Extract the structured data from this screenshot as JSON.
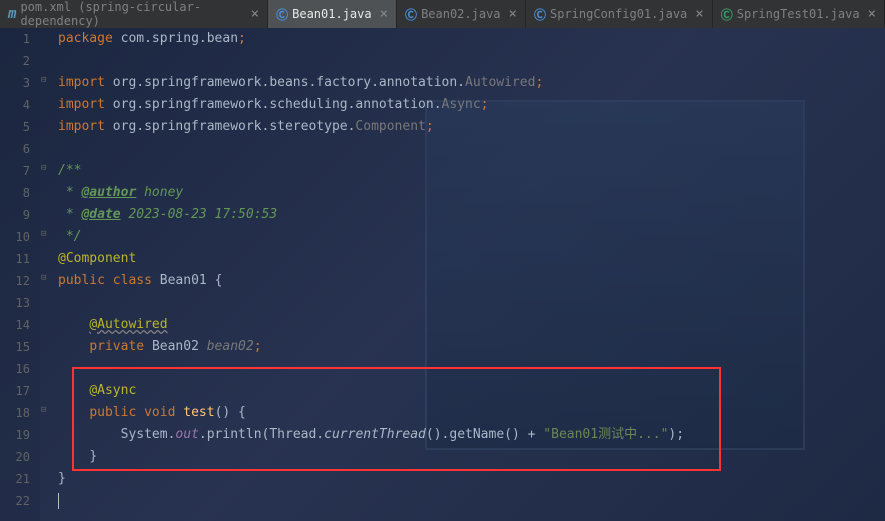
{
  "tabs": [
    {
      "icon": "m",
      "label": "pom.xml (spring-circular-dependency)",
      "active": false
    },
    {
      "icon": "c",
      "label": "Bean01.java",
      "active": true
    },
    {
      "icon": "c",
      "label": "Bean02.java",
      "active": false
    },
    {
      "icon": "c",
      "label": "SpringConfig01.java",
      "active": false
    },
    {
      "icon": "c2",
      "label": "SpringTest01.java",
      "active": false
    }
  ],
  "lines": [
    "1",
    "2",
    "3",
    "4",
    "5",
    "6",
    "7",
    "8",
    "9",
    "10",
    "11",
    "12",
    "13",
    "14",
    "15",
    "16",
    "17",
    "18",
    "19",
    "20",
    "21",
    "22"
  ],
  "code": {
    "l1_kw": "package",
    "l1_pkg": " com.spring.bean",
    "l1_semi": ";",
    "l3_kw": "import",
    "l3_pkg": " org.springframework.beans.factory.annotation.",
    "l3_cls": "Autowired",
    "l3_semi": ";",
    "l4_kw": "import",
    "l4_pkg": " org.springframework.scheduling.annotation.",
    "l4_cls": "Async",
    "l4_semi": ";",
    "l5_kw": "import",
    "l5_pkg": " org.springframework.stereotype.",
    "l5_cls": "Component",
    "l5_semi": ";",
    "l7": "/**",
    "l8_pre": " * ",
    "l8_tag": "@author",
    "l8_txt": " honey",
    "l9_pre": " * ",
    "l9_tag": "@date",
    "l9_txt": " 2023-08-23 17:50:53",
    "l10": " */",
    "l11": "@Component",
    "l12_pub": "public ",
    "l12_cls": "class ",
    "l12_name": "Bean01 ",
    "l12_br": "{",
    "l14_ind": "    ",
    "l14_anno": "@Autowired",
    "l15_ind": "    ",
    "l15_priv": "private ",
    "l15_type": "Bean02 ",
    "l15_name": "bean02",
    "l15_semi": ";",
    "l17_ind": "    ",
    "l17_anno": "@Async",
    "l18_ind": "    ",
    "l18_pub": "public ",
    "l18_void": "void ",
    "l18_name": "test",
    "l18_par": "() {",
    "l19_ind": "        ",
    "l19_sys": "System.",
    "l19_out": "out",
    "l19_dot": ".println(Thread.",
    "l19_ct": "currentThread",
    "l19_mid": "().getName() + ",
    "l19_str": "\"Bean01测试中...\"",
    "l19_end": ");",
    "l20_ind": "    ",
    "l20_br": "}",
    "l21": "}",
    "l22": ""
  }
}
